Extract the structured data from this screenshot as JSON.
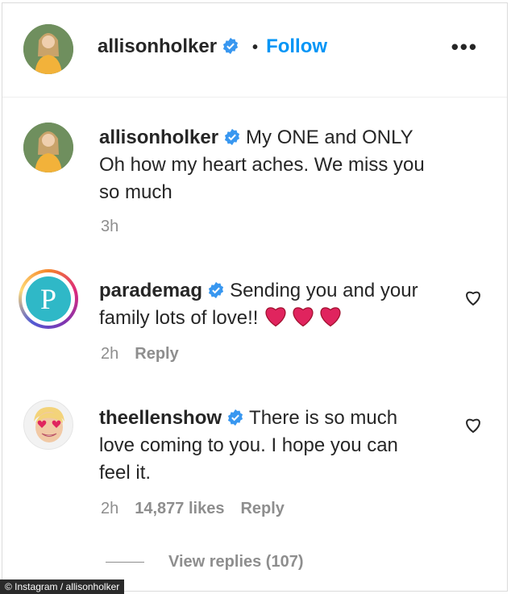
{
  "header": {
    "username": "allisonholker",
    "separator": "•",
    "follow_label": "Follow",
    "more_label": "•••"
  },
  "comments": [
    {
      "username": "allisonholker",
      "text_line1": "My ONE and ONLY",
      "text_rest": "Oh how my heart aches. We miss you so much",
      "time": "3h"
    },
    {
      "username": "parademag",
      "text": "Sending you and your family lots of love!!",
      "time": "2h",
      "reply_label": "Reply",
      "avatar_letter": "P"
    },
    {
      "username": "theellenshow",
      "text": "There is so much love coming to you. I hope you can feel it.",
      "time": "2h",
      "likes": "14,877 likes",
      "reply_label": "Reply"
    }
  ],
  "view_replies": "View replies (107)",
  "image_credit": "© Instagram / allisonholker",
  "colors": {
    "accent": "#0095f6",
    "verified": "#3897f0",
    "muted": "#8e8e8e",
    "heart_red": "#e0245e"
  }
}
